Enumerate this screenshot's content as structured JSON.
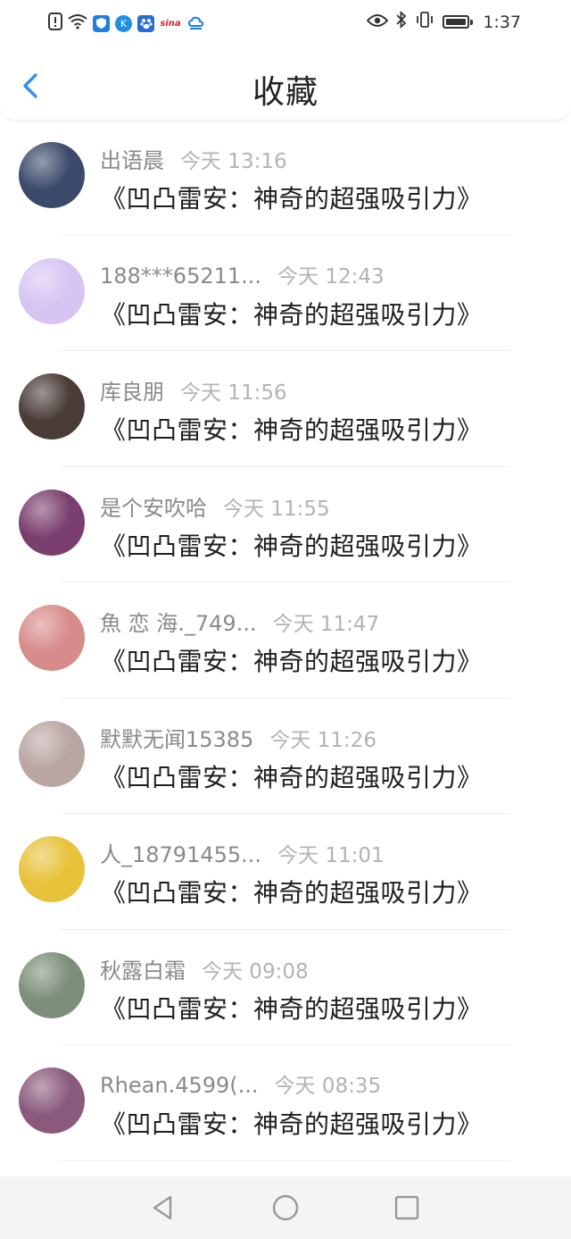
{
  "status_bar": {
    "time": "1:37",
    "left_icons": [
      "alert-icon",
      "wifi-icon",
      "shield-app-icon",
      "k-app-icon",
      "baidu-app-icon",
      "sina-app-icon",
      "cloud-app-icon"
    ],
    "sina_label": "sina",
    "k_label": "K"
  },
  "header": {
    "title": "收藏"
  },
  "items": [
    {
      "username": "出语晨",
      "time": "今天 13:16",
      "title": "《凹凸雷安：神奇的超强吸引力》",
      "avatar_color": "#3b4a6b"
    },
    {
      "username": "188***65211...",
      "time": "今天 12:43",
      "title": "《凹凸雷安：神奇的超强吸引力》",
      "avatar_color": "#d7c4f3"
    },
    {
      "username": "库良朋",
      "time": "今天 11:56",
      "title": "《凹凸雷安：神奇的超强吸引力》",
      "avatar_color": "#4a3c38"
    },
    {
      "username": "是个安吹哈",
      "time": "今天 11:55",
      "title": "《凹凸雷安：神奇的超强吸引力》",
      "avatar_color": "#7a3f6e"
    },
    {
      "username": "魚 恋 海._749...",
      "time": "今天 11:47",
      "title": "《凹凸雷安：神奇的超强吸引力》",
      "avatar_color": "#d88b8b"
    },
    {
      "username": "默默无闻15385",
      "time": "今天 11:26",
      "title": "《凹凸雷安：神奇的超强吸引力》",
      "avatar_color": "#b9a6a2"
    },
    {
      "username": "人_18791455...",
      "time": "今天 11:01",
      "title": "《凹凸雷安：神奇的超强吸引力》",
      "avatar_color": "#e7c23a"
    },
    {
      "username": "秋露白霜",
      "time": "今天 09:08",
      "title": "《凹凸雷安：神奇的超强吸引力》",
      "avatar_color": "#7d8e7a"
    },
    {
      "username": "Rhean.4599(...",
      "time": "今天 08:35",
      "title": "《凹凸雷安：神奇的超强吸引力》",
      "avatar_color": "#8a5a7c"
    }
  ],
  "colors": {
    "accent": "#2f8ff0",
    "title_text": "#1f1f1f",
    "username_text": "#8a8a8a",
    "time_text": "#b3b3b3"
  }
}
